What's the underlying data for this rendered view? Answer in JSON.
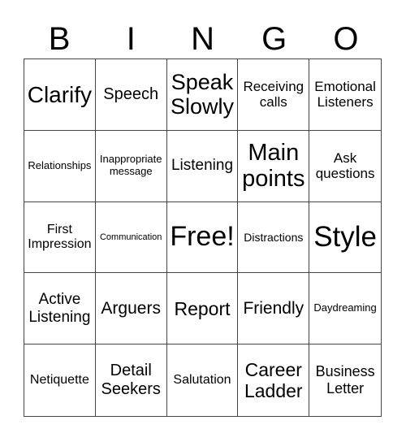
{
  "header": [
    "B",
    "I",
    "N",
    "G",
    "O"
  ],
  "cells": [
    [
      "Clarify",
      "Speech",
      "Speak Slowly",
      "Receiving calls",
      "Emotional Listeners"
    ],
    [
      "Relationships",
      "Inappropriate message",
      "Listening",
      "Main points",
      "Ask questions"
    ],
    [
      "First Impression",
      "Communication",
      "Free!",
      "Distractions",
      "Style"
    ],
    [
      "Active Listening",
      "Arguers",
      "Report",
      "Friendly",
      "Daydreaming"
    ],
    [
      "Netiquette",
      "Detail Seekers",
      "Salutation",
      "Career Ladder",
      "Business Letter"
    ]
  ]
}
